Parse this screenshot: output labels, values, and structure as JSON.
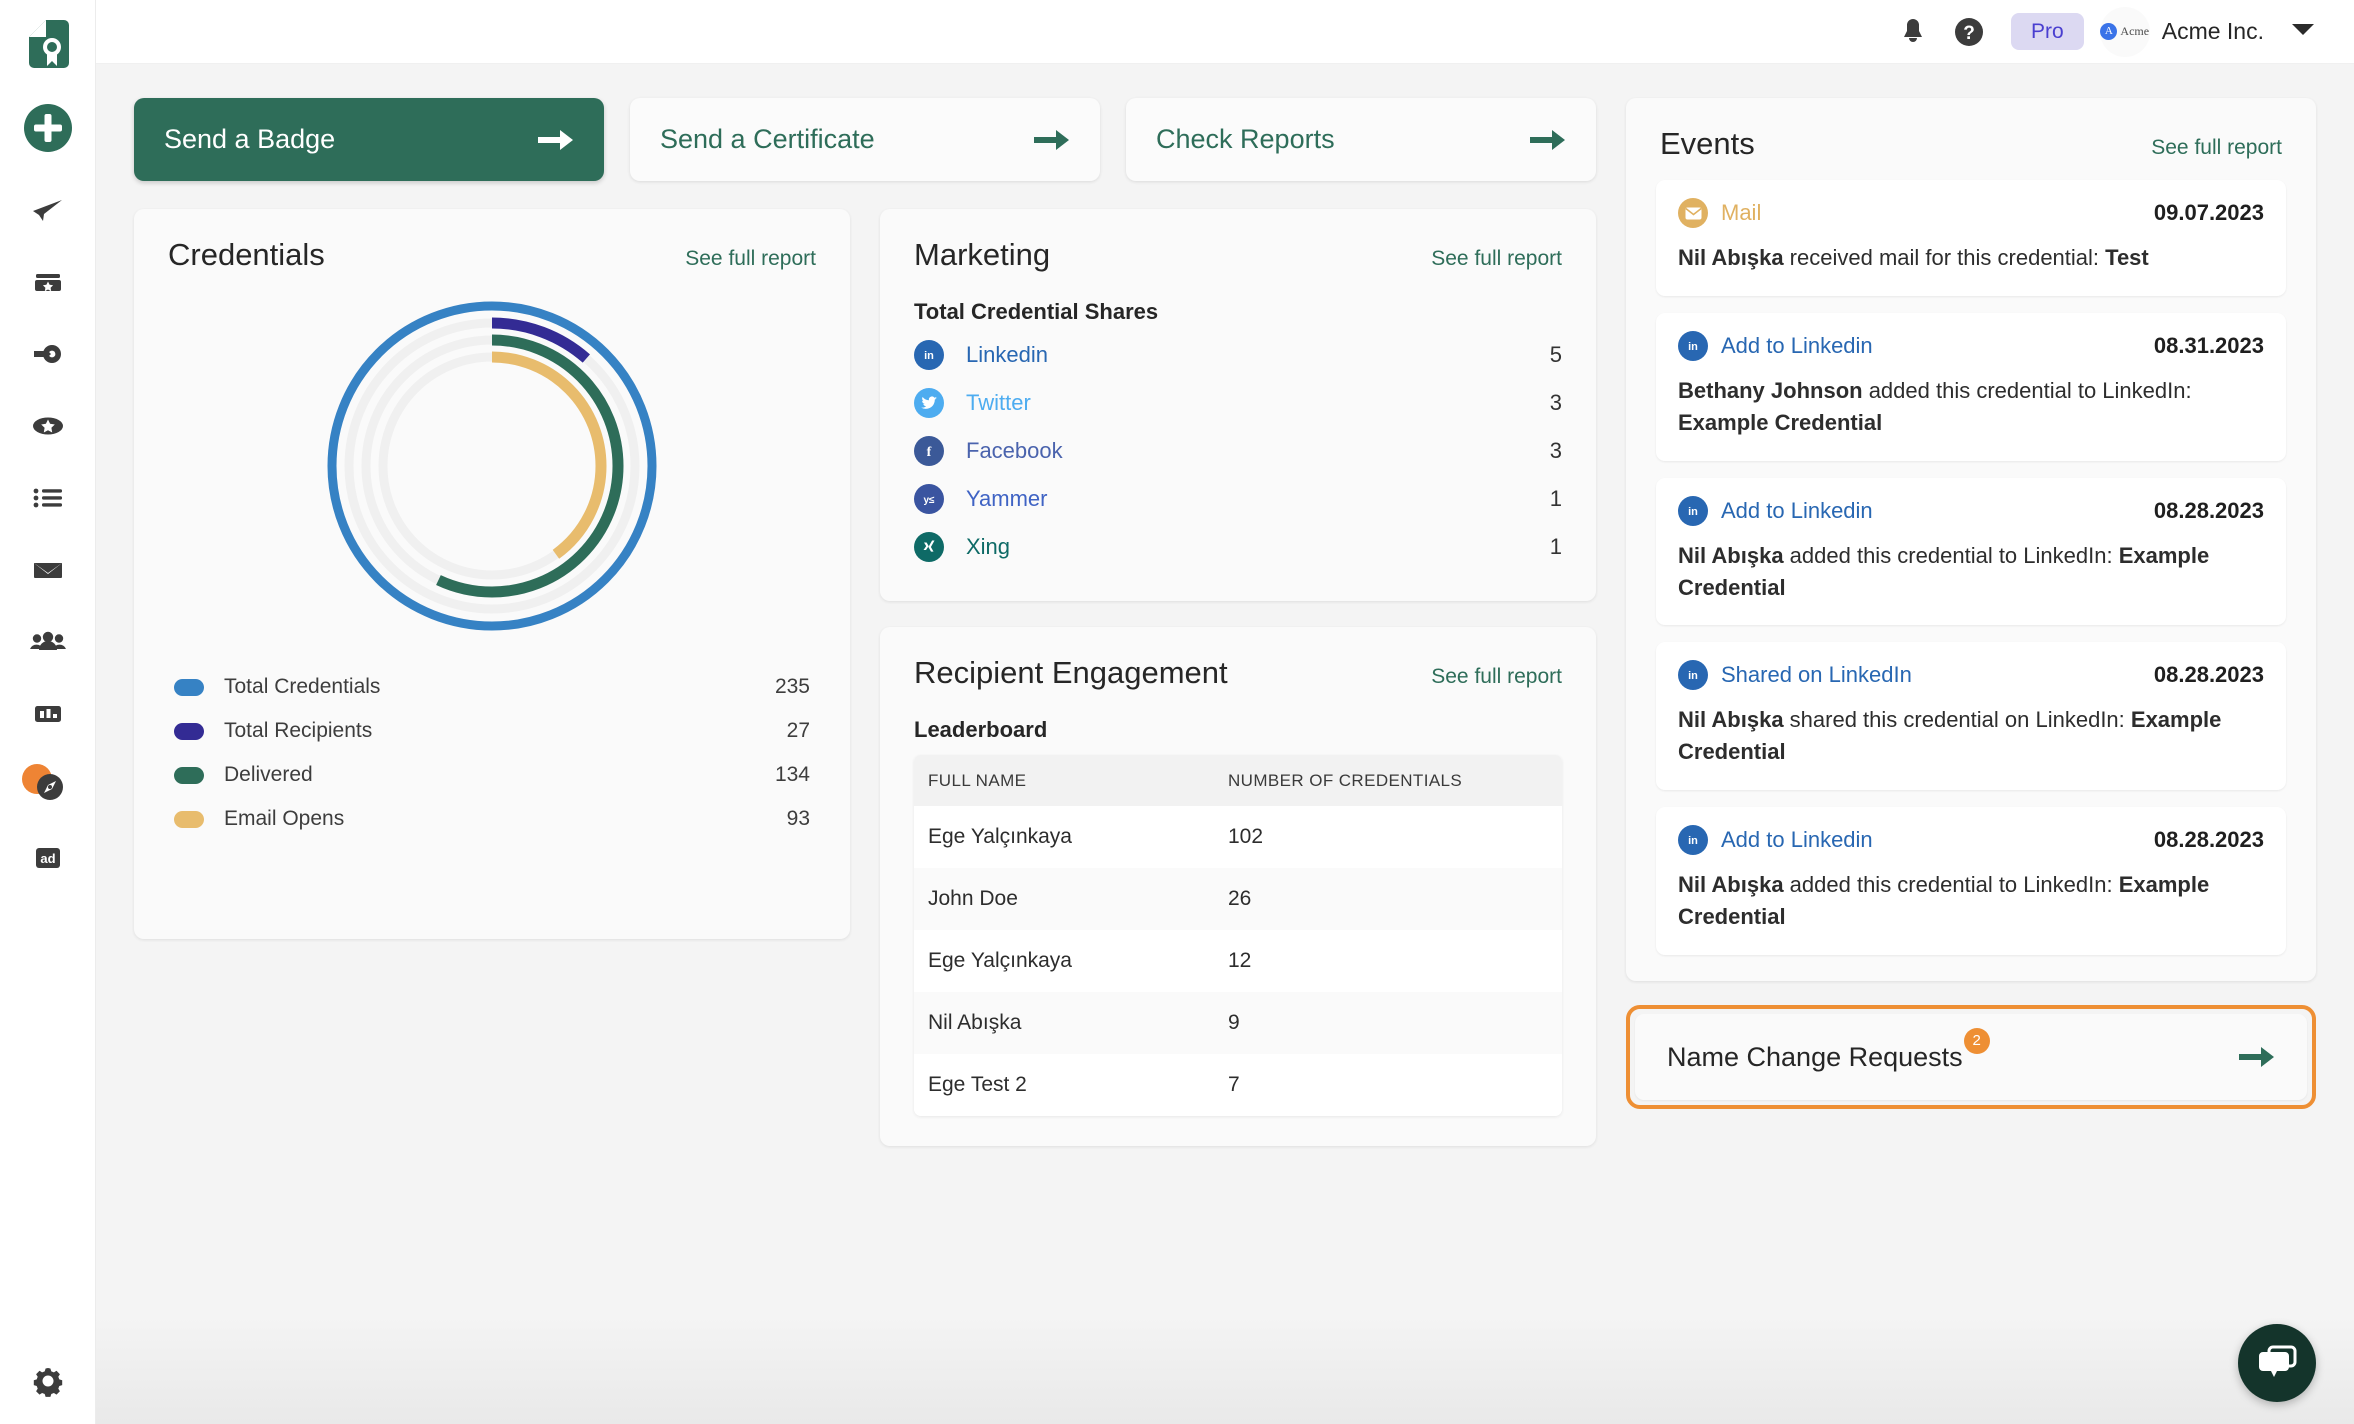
{
  "sidebar": {
    "logo": "certificate-logo",
    "add_button_label": "+",
    "items": [
      {
        "name": "send",
        "icon": "paper-plane-icon"
      },
      {
        "name": "templates",
        "icon": "archive-badge-icon"
      },
      {
        "name": "integrations",
        "icon": "gear-arrow-icon"
      },
      {
        "name": "badges",
        "icon": "star-badge-icon"
      },
      {
        "name": "lists",
        "icon": "list-icon"
      },
      {
        "name": "mail",
        "icon": "envelope-icon"
      },
      {
        "name": "recipients",
        "icon": "people-icon"
      },
      {
        "name": "analytics",
        "icon": "bar-chart-icon"
      },
      {
        "name": "explore",
        "icon": "compass-icon",
        "badge": true
      },
      {
        "name": "ads",
        "icon": "ad-icon"
      }
    ],
    "settings_icon": "gear-icon"
  },
  "topbar": {
    "notifications_icon": "bell-icon",
    "help_icon": "question-circle-icon",
    "plan_badge": "Pro",
    "org_avatar_text": "Acme",
    "org_name": "Acme Inc.",
    "caret_icon": "chevron-down-icon"
  },
  "actions": [
    {
      "label": "Send a Badge",
      "primary": true,
      "icon": "arrow-right-icon"
    },
    {
      "label": "Send a Certificate",
      "primary": false,
      "icon": "arrow-right-icon"
    },
    {
      "label": "Check Reports",
      "primary": false,
      "icon": "arrow-right-icon"
    }
  ],
  "credentials": {
    "title": "Credentials",
    "see_full_report": "See full report",
    "legend": [
      {
        "label": "Total Credentials",
        "value": "235",
        "color": "#3682c4"
      },
      {
        "label": "Total Recipients",
        "value": "27",
        "color": "#332b94"
      },
      {
        "label": "Delivered",
        "value": "134",
        "color": "#2e6d59"
      },
      {
        "label": "Email Opens",
        "value": "93",
        "color": "#e8bc6d"
      }
    ]
  },
  "marketing": {
    "title": "Marketing",
    "see_full_report": "See full report",
    "subtitle": "Total Credential Shares",
    "shares": [
      {
        "name": "Linkedin",
        "count": "5",
        "color": "#2867b2",
        "text_color": "#2867b2",
        "icon": "linkedin-icon"
      },
      {
        "name": "Twitter",
        "count": "3",
        "color": "#4dacf0",
        "text_color": "#4dacf0",
        "icon": "twitter-icon"
      },
      {
        "name": "Facebook",
        "count": "3",
        "color": "#3b5998",
        "text_color": "#4a63ad",
        "icon": "facebook-icon"
      },
      {
        "name": "Yammer",
        "count": "1",
        "color": "#3a54a0",
        "text_color": "#3f63c4",
        "icon": "yammer-icon"
      },
      {
        "name": "Xing",
        "count": "1",
        "color": "#0e6a66",
        "text_color": "#0e6a66",
        "icon": "xing-icon"
      }
    ]
  },
  "engagement": {
    "title": "Recipient Engagement",
    "see_full_report": "See full report",
    "subtitle": "Leaderboard",
    "columns": [
      "FULL NAME",
      "NUMBER OF CREDENTIALS"
    ],
    "rows": [
      {
        "name": "Ege Yalçınkaya",
        "count": "102"
      },
      {
        "name": "John Doe",
        "count": "26"
      },
      {
        "name": "Ege Yalçınkaya",
        "count": "12"
      },
      {
        "name": "Nil Abışka",
        "count": "9"
      },
      {
        "name": "Ege Test 2",
        "count": "7"
      }
    ]
  },
  "events": {
    "title": "Events",
    "see_full_report": "See full report",
    "items": [
      {
        "type": "Mail",
        "icon": "mail-circle-icon",
        "icon_color": "#e0b161",
        "type_color": "#e0b161",
        "date": "09.07.2023",
        "actor": "Nil Abışka",
        "middle": " received mail for this credential: ",
        "object": "Test"
      },
      {
        "type": "Add to Linkedin",
        "icon": "linkedin-icon",
        "icon_color": "#2867b2",
        "type_color": "#2867b2",
        "date": "08.31.2023",
        "actor": "Bethany Johnson",
        "middle": " added this credential to LinkedIn: ",
        "object": "Example Credential"
      },
      {
        "type": "Add to Linkedin",
        "icon": "linkedin-icon",
        "icon_color": "#2867b2",
        "type_color": "#2867b2",
        "date": "08.28.2023",
        "actor": "Nil Abışka",
        "middle": " added this credential to LinkedIn: ",
        "object": "Example Credential"
      },
      {
        "type": "Shared on LinkedIn",
        "icon": "linkedin-icon",
        "icon_color": "#2867b2",
        "type_color": "#2867b2",
        "date": "08.28.2023",
        "actor": "Nil Abışka",
        "middle": " shared this credential on LinkedIn: ",
        "object": "Example Credential"
      },
      {
        "type": "Add to Linkedin",
        "icon": "linkedin-icon",
        "icon_color": "#2867b2",
        "type_color": "#2867b2",
        "date": "08.28.2023",
        "actor": "Nil Abışka",
        "middle": " added this credential to LinkedIn: ",
        "object": "Example Credential"
      }
    ]
  },
  "name_change_requests": {
    "label": "Name Change Requests",
    "badge_count": "2",
    "icon": "arrow-right-icon",
    "highlight_color": "#ee8f34"
  },
  "chat": {
    "icon": "chat-bubble-icon",
    "color": "#14342b"
  },
  "chart_data": {
    "type": "pie",
    "title": "Credentials",
    "variant": "concentric-radial-gauge",
    "legend_position": "below",
    "series": [
      {
        "name": "Total Credentials",
        "value": 235,
        "ring": 1,
        "fraction": 1.0,
        "color": "#3682c4"
      },
      {
        "name": "Total Recipients",
        "value": 27,
        "ring": 2,
        "fraction": 0.115,
        "color": "#332b94"
      },
      {
        "name": "Delivered",
        "value": 134,
        "ring": 3,
        "fraction": 0.57,
        "color": "#2e6d59"
      },
      {
        "name": "Email Opens",
        "value": 93,
        "ring": 4,
        "fraction": 0.4,
        "color": "#e8bc6d"
      }
    ],
    "track_color": "#f0f0f0",
    "max": 235
  }
}
